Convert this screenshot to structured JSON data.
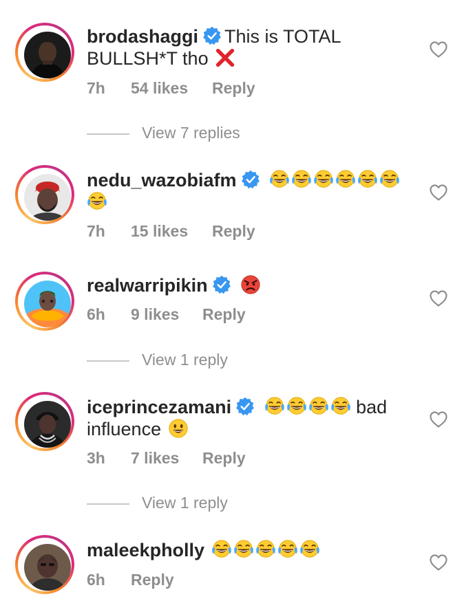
{
  "comments": [
    {
      "username": "brodashaggi",
      "text": "This is TOTAL BULLSH*T tho",
      "emojis": "cross-mark",
      "time": "7h",
      "likes": "54 likes",
      "reply": "Reply",
      "view_replies": "View 7 replies"
    },
    {
      "username": "nedu_wazobiafm",
      "text": "",
      "emojis": "tears-of-joy x7",
      "time": "7h",
      "likes": "15 likes",
      "reply": "Reply"
    },
    {
      "username": "realwarripikin",
      "text": "",
      "emojis": "angry-face",
      "time": "6h",
      "likes": "9 likes",
      "reply": "Reply",
      "view_replies": "View 1 reply"
    },
    {
      "username": "iceprincezamani",
      "text": "bad influence",
      "emojis": "tears-of-joy x4, grinning-face",
      "time": "3h",
      "likes": "7 likes",
      "reply": "Reply",
      "view_replies": "View 1 reply"
    },
    {
      "username": "maleekpholly",
      "text": "",
      "emojis": "tears-of-joy x5",
      "time": "6h",
      "reply": "Reply"
    }
  ],
  "colors": {
    "verified_blue": "#3897f0",
    "secondary_text": "#8e8e8e",
    "primary_text": "#262626"
  }
}
